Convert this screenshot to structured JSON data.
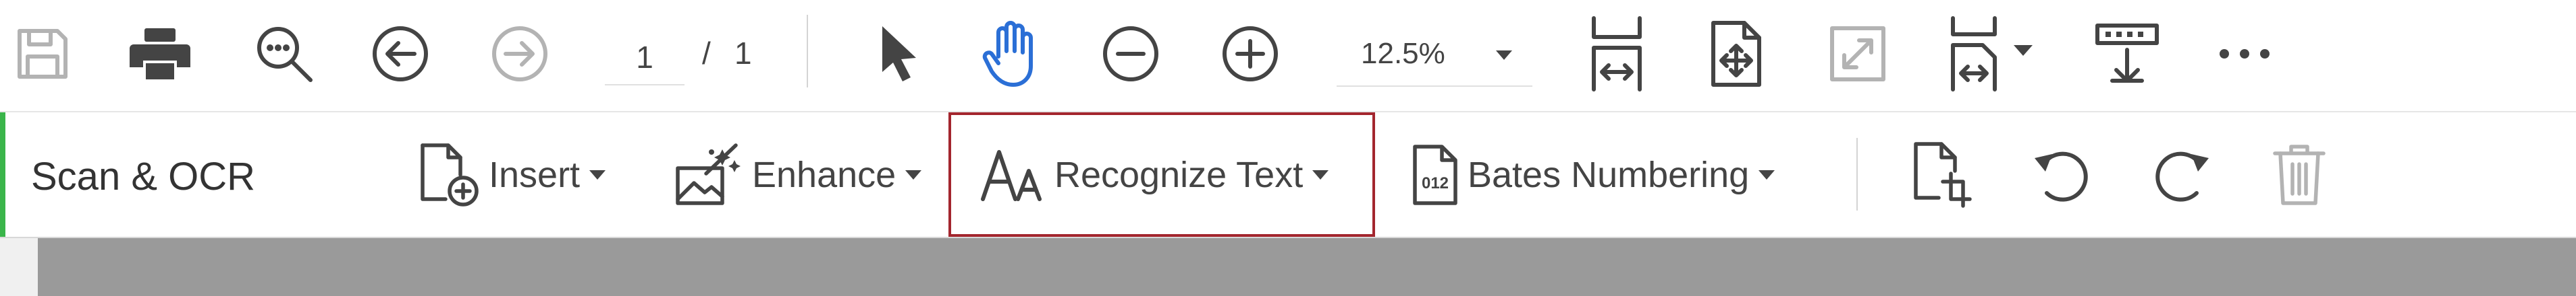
{
  "top_toolbar": {
    "icons": {
      "save": "save-icon",
      "print": "print-icon",
      "find": "find-icon",
      "previous_page": "previous-page-icon",
      "next_page": "next-page-icon",
      "select": "select-pointer-icon",
      "hand": "hand-tool-icon",
      "zoom_out": "zoom-out-icon",
      "zoom_in": "zoom-in-icon",
      "fit_page": "fit-page-icon",
      "scroll_mode": "scrolling-mode-icon",
      "full_screen": "full-screen-icon",
      "page_display": "page-display-icon",
      "read_mode": "read-mode-icon",
      "more": "more-icon"
    },
    "current_page": "1",
    "page_separator": "/",
    "total_pages": "1",
    "zoom": "12.5%"
  },
  "tool_bar": {
    "title": "Scan & OCR",
    "accent_color": "#3ab54a",
    "highlight_color": "#a3262e",
    "buttons": {
      "insert": "Insert",
      "enhance": "Enhance",
      "recognize_text": "Recognize Text",
      "bates_numbering": "Bates Numbering"
    },
    "icons": {
      "insert": "insert-page-icon",
      "enhance": "enhance-icon",
      "recognize": "recognize-text-icon",
      "bates": "bates-numbering-icon",
      "crop": "crop-pages-icon",
      "rotate_left": "rotate-left-icon",
      "rotate_right": "rotate-right-icon",
      "delete": "delete-icon"
    }
  }
}
